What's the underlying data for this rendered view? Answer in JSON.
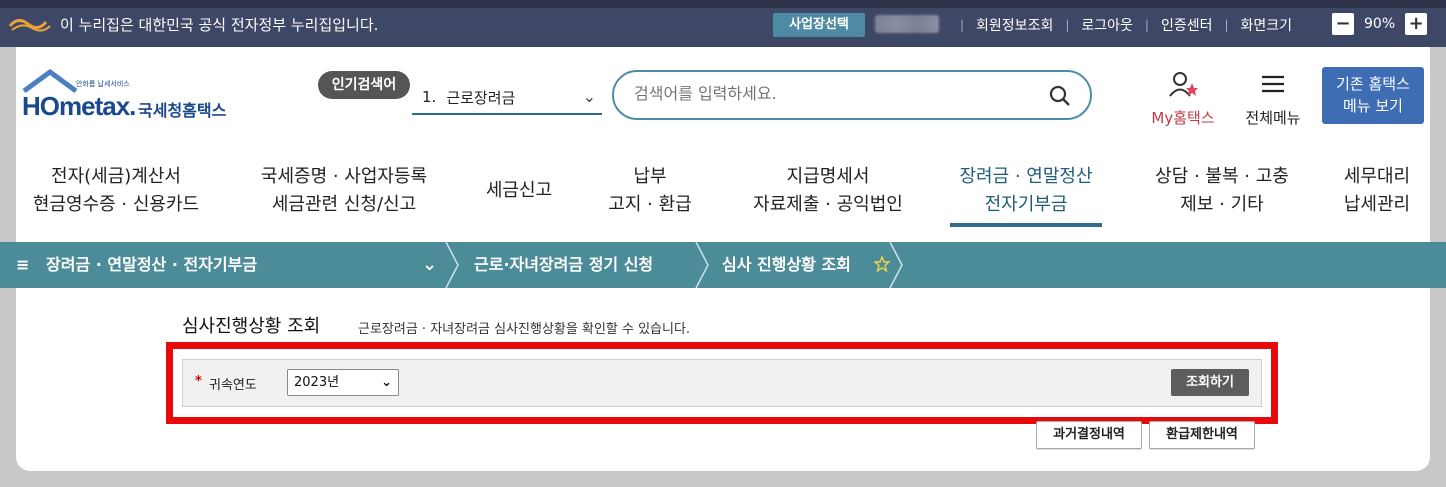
{
  "gov_bar": {
    "notice": "이 누리집은 대한민국 공식 전자정부 누리집입니다.",
    "business_select": "사업장선택",
    "links": [
      "회원정보조회",
      "로그아웃",
      "인증센터",
      "화면크기"
    ],
    "zoom_minus": "−",
    "zoom_value": "90%",
    "zoom_plus": "+"
  },
  "header": {
    "logo_brand": "HOmetax.",
    "logo_sub": "국세청홈택스",
    "logo_tiny": "안화롭 납세서비스",
    "popular_badge": "인기검색어",
    "popular_num": "1.",
    "popular_term": "근로장려금",
    "search_placeholder": "검색어를 입력하세요.",
    "my_hometax": "My홈택스",
    "all_menu": "전체메뉴",
    "old_menu_line1": "기존 홈택스",
    "old_menu_line2": "메뉴 보기"
  },
  "gnb": [
    {
      "line1": "전자(세금)계산서",
      "line2": "현금영수증 · 신용카드"
    },
    {
      "line1": "국세증명 · 사업자등록",
      "line2": "세금관련 신청/신고"
    },
    {
      "line1": "세금신고",
      "line2": ""
    },
    {
      "line1": "납부",
      "line2": "고지 · 환급"
    },
    {
      "line1": "지급명세서",
      "line2": "자료제출 · 공익법인"
    },
    {
      "line1": "장려금 · 연말정산",
      "line2": "전자기부금"
    },
    {
      "line1": "상담 · 불복 · 고충",
      "line2": "제보 · 기타"
    },
    {
      "line1": "세무대리",
      "line2": "납세관리"
    }
  ],
  "breadcrumb": {
    "menu_icon": "≡",
    "level1": "장려금 · 연말정산 · 전자기부금",
    "level2": "근로·자녀장려금 정기 신청",
    "level3": "심사 진행상황 조회"
  },
  "content": {
    "title": "심사진행상황 조회",
    "description": "근로장려금 · 자녀장려금 심사진행상황을 확인할 수 있습니다.",
    "required_mark": "*",
    "year_label": "귀속연도",
    "year_value": "2023년",
    "inquire_button": "조회하기",
    "past_button": "과거결정내역",
    "refund_limit_button": "환급제한내역"
  },
  "colors": {
    "gov_bar": "#3f4766",
    "breadcrumb_bar": "#4c8b98",
    "highlight_box": "#e70a0a",
    "accent_blue": "#3e6db3"
  }
}
